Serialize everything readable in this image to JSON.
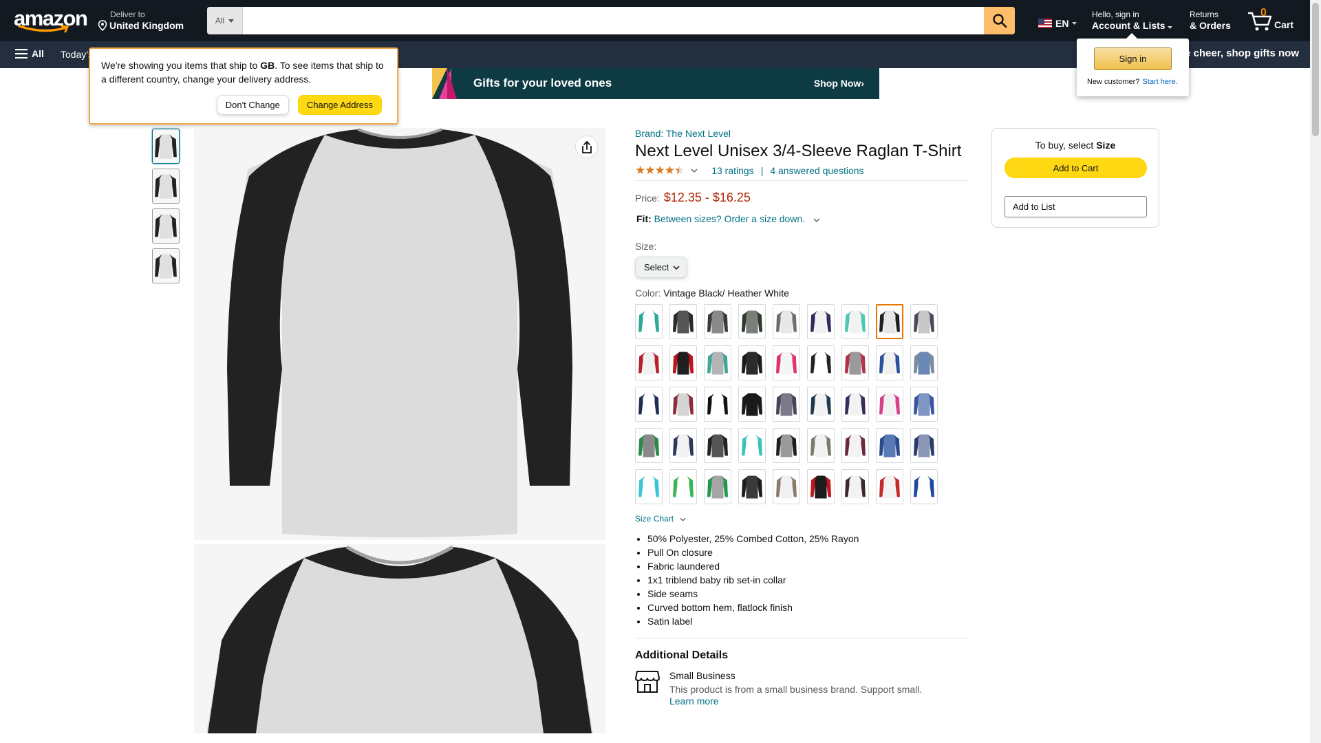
{
  "header": {
    "logo_text": "amazon",
    "deliver_line1": "Deliver to",
    "deliver_line2": "United Kingdom",
    "search_category": "All",
    "search_placeholder": "",
    "lang": "EN",
    "account_line1": "Hello, sign in",
    "account_line2": "Account & Lists",
    "returns_line1": "Returns",
    "returns_line2": "& Orders",
    "cart_count": "0",
    "cart_label": "Cart"
  },
  "nav": {
    "all_label": "All",
    "today": "Today's",
    "promo": "e cheer, shop gifts now"
  },
  "address_popover": {
    "text_pre": "We're showing you items that ship to ",
    "text_country": "GB",
    "text_post": ". To see items that ship to a different country, change your delivery address.",
    "dont_change": "Don't Change",
    "change_address": "Change Address"
  },
  "signin_popover": {
    "button": "Sign in",
    "new_customer": "New customer?",
    "start_here": "Start here."
  },
  "banner": {
    "title": "Gifts for your loved ones",
    "cta": "Shop Now›"
  },
  "product": {
    "brand": "Brand: The Next Level",
    "title": "Next Level Unisex 3/4-Sleeve Raglan T-Shirt",
    "stars": "★★★★★",
    "rating_fraction": 0.9,
    "ratings": "13 ratings",
    "questions": "4 answered questions",
    "price_label": "Price:",
    "price": "$12.35 - $16.25",
    "fit_label": "Fit:",
    "fit_text": "Between sizes? Order a size down.",
    "size_label": "Size:",
    "size_select": "Select",
    "color_label": "Color:",
    "color_value": "Vintage Black/ Heather White",
    "size_chart": "Size Chart",
    "bullets": [
      "50% Polyester, 25% Combed Cotton, 25% Rayon",
      "Pull On closure",
      "Fabric laundered",
      "1x1 triblend baby rib set-in collar",
      "Side seams",
      "Curved bottom hem, flatlock finish",
      "Satin label"
    ],
    "additional_details": "Additional Details",
    "small_business": "Small Business",
    "small_business_desc": "This product is from a small business brand. Support small.",
    "learn_more": "Learn more"
  },
  "swatches": [
    {
      "body": "#ffffff",
      "sleeve": "#2aa89a"
    },
    {
      "body": "#555555",
      "sleeve": "#2a2a2a"
    },
    {
      "body": "#8a8a8a",
      "sleeve": "#3a3a3a"
    },
    {
      "body": "#7a7f7a",
      "sleeve": "#2d3a2d"
    },
    {
      "body": "#e8e8e8",
      "sleeve": "#6d6d6d"
    },
    {
      "body": "#f2f2f2",
      "sleeve": "#312a5a"
    },
    {
      "body": "#f2f2f2",
      "sleeve": "#4fc7b3"
    },
    {
      "body": "#e6e6e6",
      "sleeve": "#1f1f1f"
    },
    {
      "body": "#c8c8c8",
      "sleeve": "#4a4a5a"
    },
    {
      "body": "#f0f0f0",
      "sleeve": "#b5202c"
    },
    {
      "body": "#1f1f1f",
      "sleeve": "#c5121f"
    },
    {
      "body": "#b5b5b5",
      "sleeve": "#3da897"
    },
    {
      "body": "#2b2b2b",
      "sleeve": "#1c1c1c"
    },
    {
      "body": "#f5f5f5",
      "sleeve": "#e0336e"
    },
    {
      "body": "#ffffff",
      "sleeve": "#222222"
    },
    {
      "body": "#9a9a9a",
      "sleeve": "#b83048"
    },
    {
      "body": "#f0f0f0",
      "sleeve": "#2a4f9c"
    },
    {
      "body": "#6b88b5",
      "sleeve": "#7f8ba0"
    },
    {
      "body": "#ffffff",
      "sleeve": "#1f2d55"
    },
    {
      "body": "#d5d5d5",
      "sleeve": "#8c2c3c"
    },
    {
      "body": "#ffffff",
      "sleeve": "#111111"
    },
    {
      "body": "#1a1a1a",
      "sleeve": "#1a1a1a"
    },
    {
      "body": "#7a7a8a",
      "sleeve": "#444455"
    },
    {
      "body": "#f2f2f2",
      "sleeve": "#1f3a4a"
    },
    {
      "body": "#f2f2f2",
      "sleeve": "#3a2a5a"
    },
    {
      "body": "#f2f2f2",
      "sleeve": "#d63f8a"
    },
    {
      "body": "#7f95c4",
      "sleeve": "#3a57a0"
    },
    {
      "body": "#8a8a8a",
      "sleeve": "#2a8a4a"
    },
    {
      "body": "#f2f2f2",
      "sleeve": "#2a3a5a"
    },
    {
      "body": "#555555",
      "sleeve": "#222222"
    },
    {
      "body": "#ffffff",
      "sleeve": "#3ac4b7"
    },
    {
      "body": "#9a9a9a",
      "sleeve": "#1c1c1c"
    },
    {
      "body": "#f2f2f2",
      "sleeve": "#7c7c6a"
    },
    {
      "body": "#f2f2f2",
      "sleeve": "#6b2a3a"
    },
    {
      "body": "#5a7ab5",
      "sleeve": "#2a4a8c"
    },
    {
      "body": "#8a98b5",
      "sleeve": "#2a3a6a"
    },
    {
      "body": "#ffffff",
      "sleeve": "#3ac4d7"
    },
    {
      "body": "#ffffff",
      "sleeve": "#3ab55a"
    },
    {
      "body": "#a5a5a5",
      "sleeve": "#1f9a4a"
    },
    {
      "body": "#3a3a3a",
      "sleeve": "#1c1c1c"
    },
    {
      "body": "#f0f0f0",
      "sleeve": "#8a7a6a"
    },
    {
      "body": "#1c1c1c",
      "sleeve": "#c5121f"
    },
    {
      "body": "#f2f2f2",
      "sleeve": "#3a2a2a"
    },
    {
      "body": "#f2f2f2",
      "sleeve": "#c52a2a"
    },
    {
      "body": "#ffffff",
      "sleeve": "#1f4aa0"
    }
  ],
  "selected_swatch_index": 7,
  "buybox": {
    "title_pre": "To buy, select ",
    "title_bold": "Size",
    "add_to_cart": "Add to Cart",
    "add_to_list": "Add to List"
  }
}
